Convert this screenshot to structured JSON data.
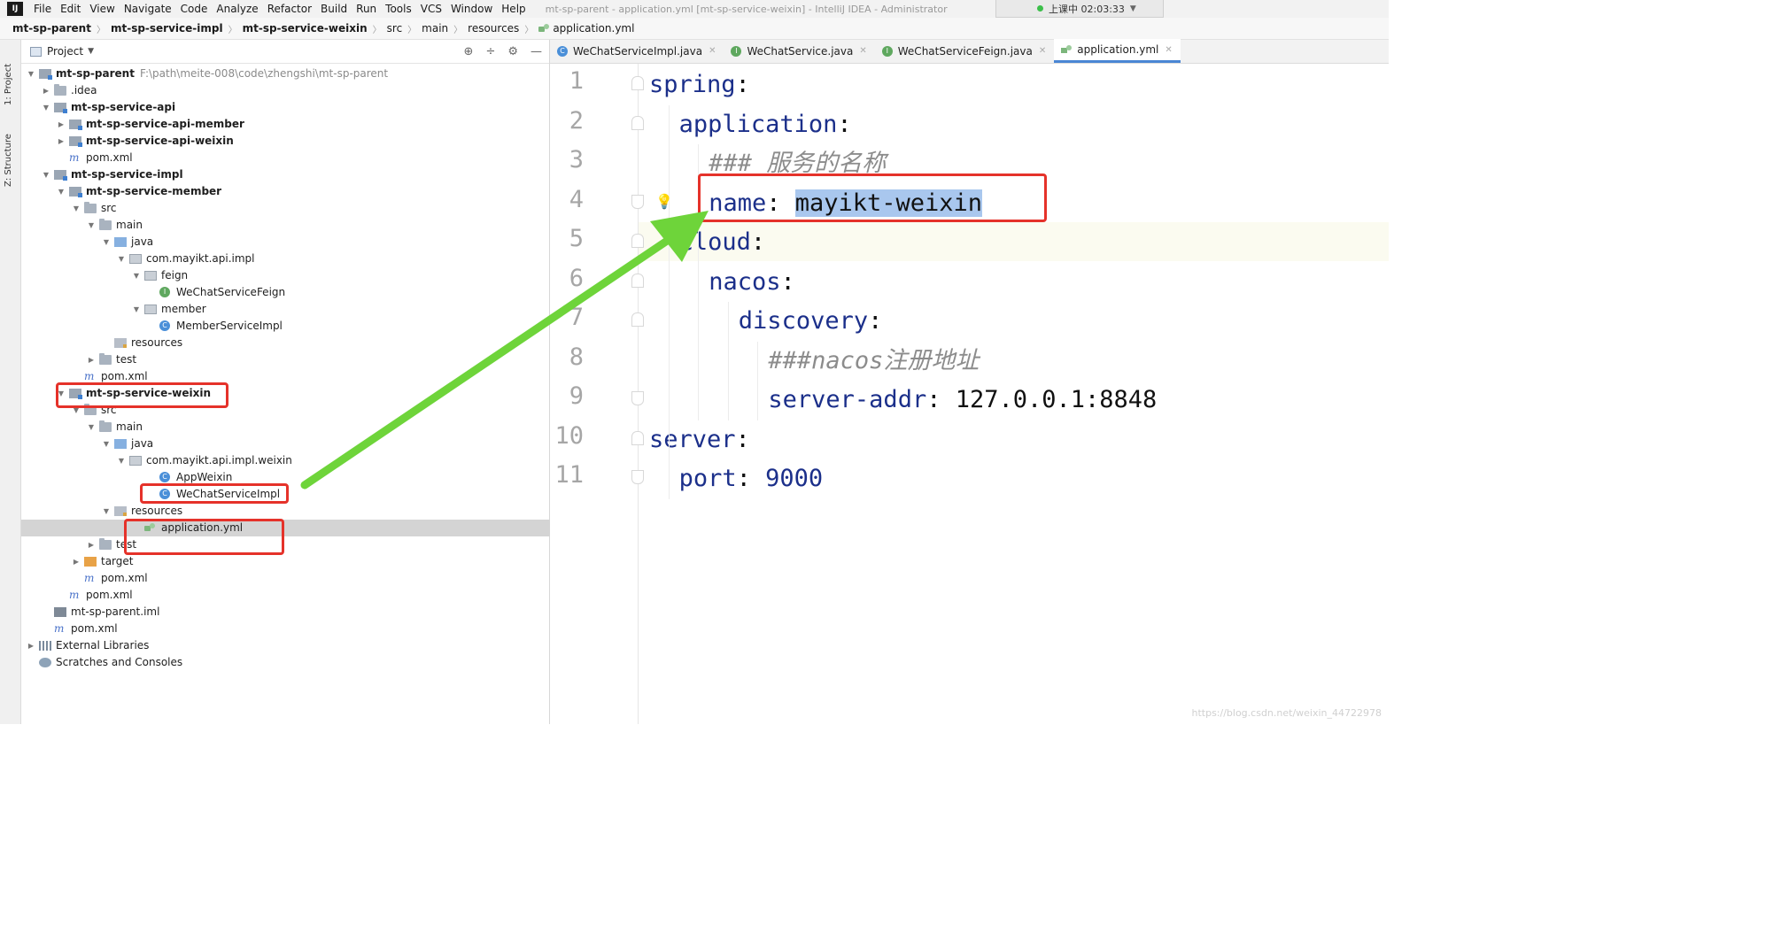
{
  "menu": {
    "app_icon": "IJ",
    "items": [
      "File",
      "Edit",
      "View",
      "Navigate",
      "Code",
      "Analyze",
      "Refactor",
      "Build",
      "Run",
      "Tools",
      "VCS",
      "Window",
      "Help"
    ],
    "window_title": "mt-sp-parent - application.yml [mt-sp-service-weixin] - IntelliJ IDEA - Administrator",
    "status_text": "上课中 02:03:33",
    "status_color": "#3cbf4a"
  },
  "breadcrumbs": [
    "mt-sp-parent",
    "mt-sp-service-impl",
    "mt-sp-service-weixin",
    "src",
    "main",
    "resources",
    "application.yml"
  ],
  "side_tabs": {
    "project": "1: Project",
    "structure": "Z: Structure"
  },
  "project_panel": {
    "title": "Project",
    "tools": [
      "crosshair-icon",
      "collapse-icon",
      "gear-icon",
      "minimize-icon"
    ],
    "tree": [
      {
        "label": "mt-sp-parent",
        "path": "F:\\path\\meite-008\\code\\zhengshi\\mt-sp-parent",
        "bold": true,
        "icon": "module",
        "depth": 0,
        "arrow": "down"
      },
      {
        "label": ".idea",
        "icon": "folder",
        "depth": 1,
        "arrow": "right"
      },
      {
        "label": "mt-sp-service-api",
        "bold": true,
        "icon": "module",
        "depth": 1,
        "arrow": "down"
      },
      {
        "label": "mt-sp-service-api-member",
        "bold": true,
        "icon": "module",
        "depth": 2,
        "arrow": "right"
      },
      {
        "label": "mt-sp-service-api-weixin",
        "bold": true,
        "icon": "module",
        "depth": 2,
        "arrow": "right"
      },
      {
        "label": "pom.xml",
        "icon": "pom",
        "depth": 2
      },
      {
        "label": "mt-sp-service-impl",
        "bold": true,
        "icon": "module",
        "depth": 1,
        "arrow": "down"
      },
      {
        "label": "mt-sp-service-member",
        "bold": true,
        "icon": "module",
        "depth": 2,
        "arrow": "down"
      },
      {
        "label": "src",
        "icon": "folder",
        "depth": 3,
        "arrow": "down"
      },
      {
        "label": "main",
        "icon": "folder",
        "depth": 4,
        "arrow": "down"
      },
      {
        "label": "java",
        "icon": "src",
        "depth": 5,
        "arrow": "down"
      },
      {
        "label": "com.mayikt.api.impl",
        "icon": "pkg",
        "depth": 6,
        "arrow": "down"
      },
      {
        "label": "feign",
        "icon": "pkg",
        "depth": 7,
        "arrow": "down"
      },
      {
        "label": "WeChatServiceFeign",
        "icon": "iface",
        "depth": 8
      },
      {
        "label": "member",
        "icon": "pkg",
        "depth": 7,
        "arrow": "down"
      },
      {
        "label": "MemberServiceImpl",
        "icon": "class",
        "depth": 8
      },
      {
        "label": "resources",
        "icon": "res",
        "depth": 5
      },
      {
        "label": "test",
        "icon": "folder",
        "depth": 4,
        "arrow": "right"
      },
      {
        "label": "pom.xml",
        "icon": "pom",
        "depth": 3
      },
      {
        "label": "mt-sp-service-weixin",
        "bold": true,
        "icon": "module",
        "depth": 2,
        "arrow": "down"
      },
      {
        "label": "src",
        "icon": "folder",
        "depth": 3,
        "arrow": "down"
      },
      {
        "label": "main",
        "icon": "folder",
        "depth": 4,
        "arrow": "down"
      },
      {
        "label": "java",
        "icon": "src",
        "depth": 5,
        "arrow": "down"
      },
      {
        "label": "com.mayikt.api.impl.weixin",
        "icon": "pkg",
        "depth": 6,
        "arrow": "down"
      },
      {
        "label": "AppWeixin",
        "icon": "class",
        "depth": 8
      },
      {
        "label": "WeChatServiceImpl",
        "icon": "class",
        "depth": 8
      },
      {
        "label": "resources",
        "icon": "res",
        "depth": 5,
        "arrow": "down"
      },
      {
        "label": "application.yml",
        "icon": "yml",
        "depth": 7,
        "selected": true
      },
      {
        "label": "test",
        "icon": "folder",
        "depth": 4,
        "arrow": "right"
      },
      {
        "label": "target",
        "icon": "target",
        "depth": 3,
        "arrow": "right"
      },
      {
        "label": "pom.xml",
        "icon": "pom",
        "depth": 3
      },
      {
        "label": "pom.xml",
        "icon": "pom",
        "depth": 2
      },
      {
        "label": "mt-sp-parent.iml",
        "icon": "iml",
        "depth": 1
      },
      {
        "label": "pom.xml",
        "icon": "pom",
        "depth": 1
      },
      {
        "label": "External Libraries",
        "icon": "libs",
        "depth": 0,
        "arrow": "right"
      },
      {
        "label": "Scratches and Consoles",
        "icon": "scratch",
        "depth": 0
      }
    ]
  },
  "editor": {
    "tabs": [
      {
        "label": "WeChatServiceImpl.java",
        "icon": "class",
        "active": false
      },
      {
        "label": "WeChatService.java",
        "icon": "iface",
        "active": false
      },
      {
        "label": "WeChatServiceFeign.java",
        "icon": "iface",
        "active": false
      },
      {
        "label": "application.yml",
        "icon": "yml",
        "active": true
      }
    ],
    "lines": [
      {
        "n": "1",
        "indent": 0,
        "parts": [
          {
            "t": "spring",
            "c": "key"
          },
          {
            "t": ":",
            "c": "val"
          }
        ]
      },
      {
        "n": "2",
        "indent": 1,
        "parts": [
          {
            "t": "application",
            "c": "key"
          },
          {
            "t": ":",
            "c": "val"
          }
        ]
      },
      {
        "n": "3",
        "indent": 2,
        "parts": [
          {
            "t": "### 服务的名称",
            "c": "cmt"
          }
        ]
      },
      {
        "n": "4",
        "indent": 2,
        "parts": [
          {
            "t": "name",
            "c": "key"
          },
          {
            "t": ": ",
            "c": "val"
          },
          {
            "t": "mayikt-weixin",
            "c": "val sel"
          }
        ]
      },
      {
        "n": "5",
        "indent": 1,
        "parts": [
          {
            "t": "cloud",
            "c": "key"
          },
          {
            "t": ":",
            "c": "val"
          }
        ]
      },
      {
        "n": "6",
        "indent": 2,
        "parts": [
          {
            "t": "nacos",
            "c": "key"
          },
          {
            "t": ":",
            "c": "val"
          }
        ]
      },
      {
        "n": "7",
        "indent": 3,
        "parts": [
          {
            "t": "discovery",
            "c": "key"
          },
          {
            "t": ":",
            "c": "val"
          }
        ]
      },
      {
        "n": "8",
        "indent": 4,
        "parts": [
          {
            "t": "###nacos注册地址",
            "c": "cmt"
          }
        ]
      },
      {
        "n": "9",
        "indent": 4,
        "parts": [
          {
            "t": "server-addr",
            "c": "key"
          },
          {
            "t": ": ",
            "c": "val"
          },
          {
            "t": "127.0.0.1:8848",
            "c": "val"
          }
        ]
      },
      {
        "n": "10",
        "indent": 0,
        "parts": [
          {
            "t": "server",
            "c": "key"
          },
          {
            "t": ":",
            "c": "val"
          }
        ]
      },
      {
        "n": "11",
        "indent": 1,
        "parts": [
          {
            "t": "port",
            "c": "key"
          },
          {
            "t": ": ",
            "c": "val"
          },
          {
            "t": "9000",
            "c": "num"
          }
        ]
      }
    ]
  },
  "watermark": "https://blog.csdn.net/weixin_44722978",
  "colors": {
    "annotation_red": "#e5322a",
    "annotation_arrow": "#6ed43a",
    "selection": "#a9c7ee",
    "yaml_key": "#1b2f8a"
  }
}
